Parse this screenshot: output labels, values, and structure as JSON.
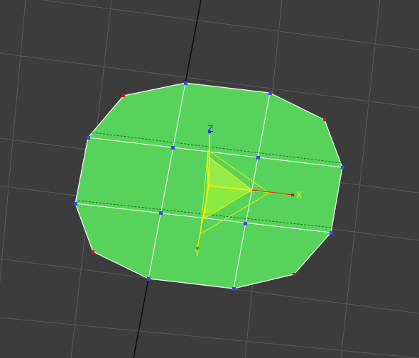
{
  "viewport": {
    "background": "#3c3c3c",
    "grid_color": "#5b5b5b",
    "major_axis_color": "#0c0c0c"
  },
  "mesh": {
    "face_color": "#57d35c",
    "edge_color": "#ffffff",
    "hidden_edge_color": "#1d6b24",
    "vertex_selected_color": "#3f48e0",
    "vertex_color": "#e01818"
  },
  "gizmo": {
    "color": "#f3f400",
    "labels": {
      "x": "X",
      "y": "Y",
      "z": "Z"
    },
    "x_axis_color": "#d0201d",
    "y_axis_color": "#33aa22",
    "z_axis_color": "#2030d0"
  }
}
